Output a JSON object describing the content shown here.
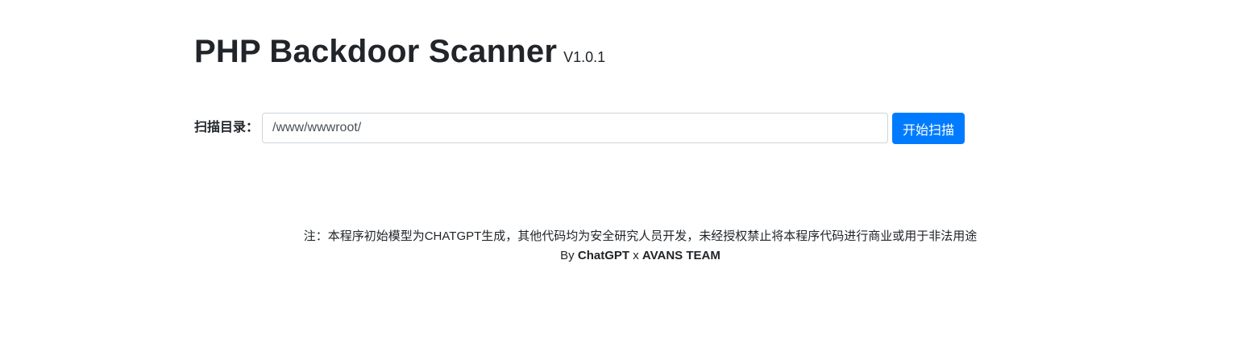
{
  "header": {
    "title": "PHP Backdoor Scanner",
    "version": "V1.0.1"
  },
  "scan_form": {
    "label": "扫描目录：",
    "input_value": "/www/wwwroot/",
    "button_label": "开始扫描"
  },
  "footer": {
    "note": "注：本程序初始模型为CHATGPT生成，其他代码均为安全研究人员开发，未经授权禁止将本程序代码进行商业或用于非法用途",
    "credit_prefix": "By",
    "credit_author1": "ChatGPT",
    "credit_joiner": "x",
    "credit_author2": "AVANS TEAM"
  },
  "colors": {
    "accent": "#007bff",
    "text": "#212529",
    "input_border": "#ced4da"
  }
}
